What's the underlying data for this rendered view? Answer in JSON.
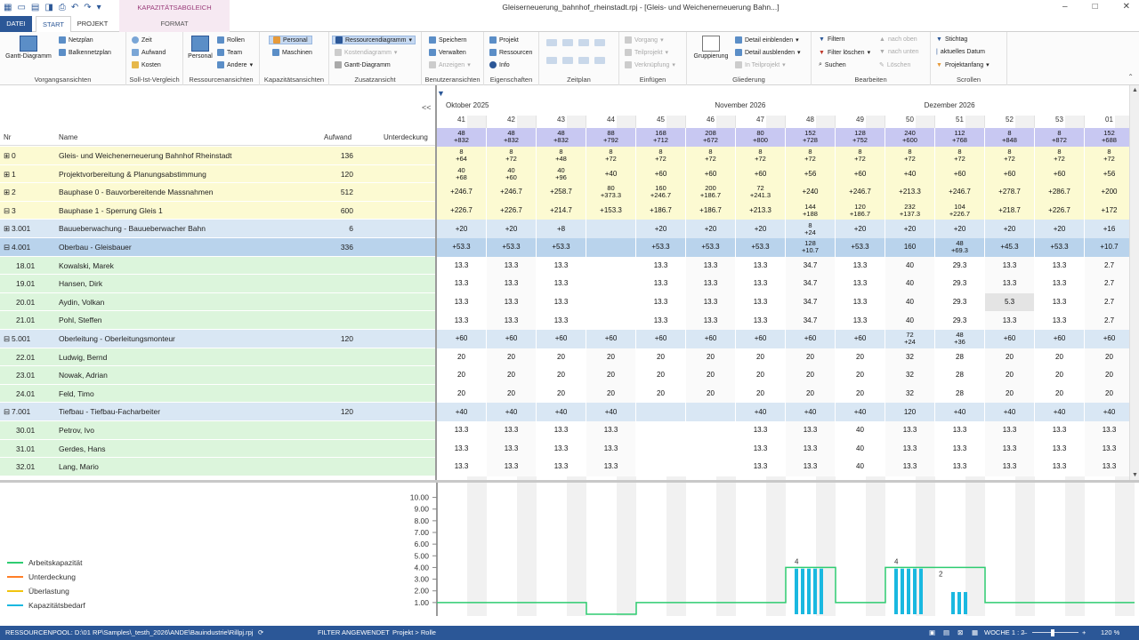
{
  "title_bar": {
    "ctx_tab": "KAPAZITÄTSABGLEICH PERSONAL",
    "doc_title": "Gleiserneuerung_bahnhof_rheinstadt.rpj - [Gleis- und Weichenerneuerung Bahn...]"
  },
  "tabs": {
    "datei": "DATEI",
    "start": "START",
    "projekt": "PROJEKT",
    "format": "FORMAT"
  },
  "ribbon": {
    "vorgangsansichten": {
      "label": "Vorgangsansichten",
      "gantt": "Gantt-Diagramm",
      "netzplan": "Netzplan",
      "balken": "Balkennetzplan"
    },
    "soll_ist": {
      "label": "Soll-Ist-Vergleich",
      "zeit": "Zeit",
      "aufwand": "Aufwand",
      "kosten": "Kosten"
    },
    "ressourcen": {
      "label": "Ressourcenansichten",
      "personal": "Personal",
      "rollen": "Rollen",
      "team": "Team",
      "andere": "Andere"
    },
    "kapazitaet": {
      "label": "Kapazitätsansichten",
      "personal": "Personal",
      "maschinen": "Maschinen"
    },
    "zusatz": {
      "label": "Zusatzansicht",
      "ressourcendiagramm": "Ressourcendiagramm",
      "kostendiagramm": "Kostendiagramm",
      "gantt": "Gantt-Diagramm"
    },
    "benutzer": {
      "label": "Benutzeransichten",
      "speichern": "Speichern",
      "verwalten": "Verwalten",
      "anzeigen": "Anzeigen"
    },
    "eigenschaften": {
      "label": "Eigenschaften",
      "projekt": "Projekt",
      "ressourcen": "Ressourcen",
      "info": "Info"
    },
    "zeitplan": {
      "label": "Zeitplan"
    },
    "einfuegen": {
      "label": "Einfügen",
      "vorgang": "Vorgang",
      "teilprojekt": "Teilprojekt",
      "verknuepfung": "Verknüpfung"
    },
    "gliederung": {
      "label": "Gliederung",
      "gruppierung": "Gruppierung",
      "einblenden": "Detail einblenden",
      "ausblenden": "Detail ausblenden",
      "im_teilprojekt": "In Teilprojekt"
    },
    "bearbeiten": {
      "label": "Bearbeiten",
      "filtern": "Filtern",
      "filter_loeschen": "Filter löschen",
      "suchen": "Suchen",
      "nach_oben": "nach oben",
      "nach_unten": "nach unten",
      "loeschen": "Löschen"
    },
    "scrollen": {
      "label": "Scrollen",
      "stichtag": "Stichtag",
      "aktuelles_datum": "aktuelles Datum",
      "projektanfang": "Projektanfang"
    }
  },
  "table": {
    "col_nr": "Nr",
    "col_name": "Name",
    "col_aufwand": "Aufwand",
    "col_unterdeckung": "Unterdeckung",
    "collapse": "<<",
    "rows": [
      {
        "nr": "0",
        "name": "Gleis- und Weichenerneuerung Bahnhof Rheinstadt",
        "aufwand": "136",
        "style": "y",
        "exp": "⊞"
      },
      {
        "nr": "1",
        "name": "Projektvorbereitung & Planungsabstimmung",
        "aufwand": "120",
        "style": "y",
        "exp": "⊞"
      },
      {
        "nr": "2",
        "name": "Bauphase 0 - Bauvorbereitende Massnahmen",
        "aufwand": "512",
        "style": "y",
        "exp": "⊞"
      },
      {
        "nr": "3",
        "name": "Bauphase 1 - Sperrung Gleis 1",
        "aufwand": "600",
        "style": "y",
        "exp": "⊟"
      },
      {
        "nr": "3.001",
        "name": "Bauueberwachung - Bauueberwacher Bahn",
        "aufwand": "6",
        "style": "b",
        "exp": "⊞"
      },
      {
        "nr": "4.001",
        "name": "Oberbau - Gleisbauer",
        "aufwand": "336",
        "style": "bs",
        "exp": "⊟"
      },
      {
        "nr": "18.01",
        "name": "Kowalski, Marek",
        "aufwand": "",
        "style": "g",
        "exp": ""
      },
      {
        "nr": "19.01",
        "name": "Hansen, Dirk",
        "aufwand": "",
        "style": "g",
        "exp": ""
      },
      {
        "nr": "20.01",
        "name": "Aydin, Volkan",
        "aufwand": "",
        "style": "g",
        "exp": ""
      },
      {
        "nr": "21.01",
        "name": "Pohl, Steffen",
        "aufwand": "",
        "style": "g",
        "exp": ""
      },
      {
        "nr": "5.001",
        "name": "Oberleitung - Oberleitungsmonteur",
        "aufwand": "120",
        "style": "b",
        "exp": "⊟"
      },
      {
        "nr": "22.01",
        "name": "Ludwig, Bernd",
        "aufwand": "",
        "style": "g",
        "exp": ""
      },
      {
        "nr": "23.01",
        "name": "Nowak, Adrian",
        "aufwand": "",
        "style": "g",
        "exp": ""
      },
      {
        "nr": "24.01",
        "name": "Feld, Timo",
        "aufwand": "",
        "style": "g",
        "exp": ""
      },
      {
        "nr": "7.001",
        "name": "Tiefbau - Tiefbau-Facharbeiter",
        "aufwand": "120",
        "style": "b",
        "exp": "⊟"
      },
      {
        "nr": "30.01",
        "name": "Petrov, Ivo",
        "aufwand": "",
        "style": "g",
        "exp": ""
      },
      {
        "nr": "31.01",
        "name": "Gerdes, Hans",
        "aufwand": "",
        "style": "g",
        "exp": ""
      },
      {
        "nr": "32.01",
        "name": "Lang, Mario",
        "aufwand": "",
        "style": "g",
        "exp": ""
      }
    ]
  },
  "timeline": {
    "months": [
      {
        "label": "Oktober 2025",
        "col": 0
      },
      {
        "label": "November 2026",
        "col": 5.4
      },
      {
        "label": "Dezember 2026",
        "col": 9.6
      }
    ],
    "weeks": [
      "41",
      "42",
      "43",
      "44",
      "45",
      "46",
      "47",
      "48",
      "49",
      "50",
      "51",
      "52",
      "53",
      "01"
    ],
    "summary": [
      [
        "48",
        "+832"
      ],
      [
        "48",
        "+832"
      ],
      [
        "48",
        "+832"
      ],
      [
        "88",
        "+792"
      ],
      [
        "168",
        "+712"
      ],
      [
        "208",
        "+672"
      ],
      [
        "80",
        "+800"
      ],
      [
        "152",
        "+728"
      ],
      [
        "128",
        "+752"
      ],
      [
        "240",
        "+600"
      ],
      [
        "112",
        "+768"
      ],
      [
        "8",
        "+848"
      ],
      [
        "8",
        "+872"
      ],
      [
        "152",
        "+688"
      ]
    ],
    "cells": [
      [
        [
          "8",
          "+64"
        ],
        [
          "8",
          "+72"
        ],
        [
          "8",
          "+48"
        ],
        [
          "8",
          "+72"
        ],
        [
          "8",
          "+72"
        ],
        [
          "8",
          "+72"
        ],
        [
          "8",
          "+72"
        ],
        [
          "8",
          "+72"
        ],
        [
          "8",
          "+72"
        ],
        [
          "8",
          "+72"
        ],
        [
          "8",
          "+72"
        ],
        [
          "8",
          "+72"
        ],
        [
          "8",
          "+72"
        ],
        [
          "8",
          "+72"
        ]
      ],
      [
        [
          "40",
          "+68"
        ],
        [
          "40",
          "+60"
        ],
        [
          "40",
          "+96"
        ],
        [
          "+40"
        ],
        [
          "+60"
        ],
        [
          "+60"
        ],
        [
          "+60"
        ],
        [
          "+56"
        ],
        [
          "+60"
        ],
        [
          "+40"
        ],
        [
          "+60"
        ],
        [
          "+60"
        ],
        [
          "+60"
        ],
        [
          "+56"
        ]
      ],
      [
        [
          "+246.7"
        ],
        [
          "+246.7"
        ],
        [
          "+258.7"
        ],
        [
          "80",
          "+373.3"
        ],
        [
          "160",
          "+246.7"
        ],
        [
          "200",
          "+186.7"
        ],
        [
          "72",
          "+241.3"
        ],
        [
          "+240"
        ],
        [
          "+246.7"
        ],
        [
          "+213.3"
        ],
        [
          "+246.7"
        ],
        [
          "+278.7"
        ],
        [
          "+286.7"
        ],
        [
          "+200"
        ]
      ],
      [
        [
          "+226.7"
        ],
        [
          "+226.7"
        ],
        [
          "+214.7"
        ],
        [
          "+153.3"
        ],
        [
          "+186.7"
        ],
        [
          "+186.7"
        ],
        [
          "+213.3"
        ],
        [
          "144",
          "+188"
        ],
        [
          "120",
          "+186.7"
        ],
        [
          "232",
          "+137.3"
        ],
        [
          "104",
          "+226.7"
        ],
        [
          "+218.7"
        ],
        [
          "+226.7"
        ],
        [
          "+172"
        ]
      ],
      [
        [
          "+20"
        ],
        [
          "+20"
        ],
        [
          "+8"
        ],
        [
          ""
        ],
        [
          "+20"
        ],
        [
          "+20"
        ],
        [
          "+20"
        ],
        [
          "8",
          "+24"
        ],
        [
          "+20"
        ],
        [
          "+20"
        ],
        [
          "+20"
        ],
        [
          "+20"
        ],
        [
          "+20"
        ],
        [
          "+16"
        ]
      ],
      [
        [
          "+53.3"
        ],
        [
          "+53.3"
        ],
        [
          "+53.3"
        ],
        [
          ""
        ],
        [
          "+53.3"
        ],
        [
          "+53.3"
        ],
        [
          "+53.3"
        ],
        [
          "128",
          "+10.7"
        ],
        [
          "+53.3"
        ],
        [
          "160"
        ],
        [
          "48",
          "+69.3"
        ],
        [
          "+45.3"
        ],
        [
          "+53.3"
        ],
        [
          "+10.7"
        ]
      ],
      [
        [
          "13.3"
        ],
        [
          "13.3"
        ],
        [
          "13.3"
        ],
        [
          ""
        ],
        [
          "13.3"
        ],
        [
          "13.3"
        ],
        [
          "13.3"
        ],
        [
          "34.7"
        ],
        [
          "13.3"
        ],
        [
          "40"
        ],
        [
          "29.3"
        ],
        [
          "13.3"
        ],
        [
          "13.3"
        ],
        [
          "2.7"
        ]
      ],
      [
        [
          "13.3"
        ],
        [
          "13.3"
        ],
        [
          "13.3"
        ],
        [
          ""
        ],
        [
          "13.3"
        ],
        [
          "13.3"
        ],
        [
          "13.3"
        ],
        [
          "34.7"
        ],
        [
          "13.3"
        ],
        [
          "40"
        ],
        [
          "29.3"
        ],
        [
          "13.3"
        ],
        [
          "13.3"
        ],
        [
          "2.7"
        ]
      ],
      [
        [
          "13.3"
        ],
        [
          "13.3"
        ],
        [
          "13.3"
        ],
        [
          ""
        ],
        [
          "13.3"
        ],
        [
          "13.3"
        ],
        [
          "13.3"
        ],
        [
          "34.7"
        ],
        [
          "13.3"
        ],
        [
          "40"
        ],
        [
          "29.3"
        ],
        [
          "5.3"
        ],
        [
          "13.3"
        ],
        [
          "2.7"
        ]
      ],
      [
        [
          "13.3"
        ],
        [
          "13.3"
        ],
        [
          "13.3"
        ],
        [
          ""
        ],
        [
          "13.3"
        ],
        [
          "13.3"
        ],
        [
          "13.3"
        ],
        [
          "34.7"
        ],
        [
          "13.3"
        ],
        [
          "40"
        ],
        [
          "29.3"
        ],
        [
          "13.3"
        ],
        [
          "13.3"
        ],
        [
          "2.7"
        ]
      ],
      [
        [
          "+60"
        ],
        [
          "+60"
        ],
        [
          "+60"
        ],
        [
          "+60"
        ],
        [
          "+60"
        ],
        [
          "+60"
        ],
        [
          "+60"
        ],
        [
          "+60"
        ],
        [
          "+60"
        ],
        [
          "72",
          "+24"
        ],
        [
          "48",
          "+36"
        ],
        [
          "+60"
        ],
        [
          "+60"
        ],
        [
          "+60"
        ]
      ],
      [
        [
          "20"
        ],
        [
          "20"
        ],
        [
          "20"
        ],
        [
          "20"
        ],
        [
          "20"
        ],
        [
          "20"
        ],
        [
          "20"
        ],
        [
          "20"
        ],
        [
          "20"
        ],
        [
          "32"
        ],
        [
          "28"
        ],
        [
          "20"
        ],
        [
          "20"
        ],
        [
          "20"
        ]
      ],
      [
        [
          "20"
        ],
        [
          "20"
        ],
        [
          "20"
        ],
        [
          "20"
        ],
        [
          "20"
        ],
        [
          "20"
        ],
        [
          "20"
        ],
        [
          "20"
        ],
        [
          "20"
        ],
        [
          "32"
        ],
        [
          "28"
        ],
        [
          "20"
        ],
        [
          "20"
        ],
        [
          "20"
        ]
      ],
      [
        [
          "20"
        ],
        [
          "20"
        ],
        [
          "20"
        ],
        [
          "20"
        ],
        [
          "20"
        ],
        [
          "20"
        ],
        [
          "20"
        ],
        [
          "20"
        ],
        [
          "20"
        ],
        [
          "32"
        ],
        [
          "28"
        ],
        [
          "20"
        ],
        [
          "20"
        ],
        [
          "20"
        ]
      ],
      [
        [
          "+40"
        ],
        [
          "+40"
        ],
        [
          "+40"
        ],
        [
          "+40"
        ],
        [
          ""
        ],
        [
          ""
        ],
        [
          "+40"
        ],
        [
          "+40"
        ],
        [
          "+40"
        ],
        [
          "120"
        ],
        [
          "+40"
        ],
        [
          "+40"
        ],
        [
          "+40"
        ],
        [
          "+40"
        ]
      ],
      [
        [
          "13.3"
        ],
        [
          "13.3"
        ],
        [
          "13.3"
        ],
        [
          "13.3"
        ],
        [
          ""
        ],
        [
          ""
        ],
        [
          "13.3"
        ],
        [
          "13.3"
        ],
        [
          "40"
        ],
        [
          "13.3"
        ],
        [
          "13.3"
        ],
        [
          "13.3"
        ],
        [
          "13.3"
        ],
        [
          "13.3"
        ]
      ],
      [
        [
          "13.3"
        ],
        [
          "13.3"
        ],
        [
          "13.3"
        ],
        [
          "13.3"
        ],
        [
          ""
        ],
        [
          ""
        ],
        [
          "13.3"
        ],
        [
          "13.3"
        ],
        [
          "40"
        ],
        [
          "13.3"
        ],
        [
          "13.3"
        ],
        [
          "13.3"
        ],
        [
          "13.3"
        ],
        [
          "13.3"
        ]
      ],
      [
        [
          "13.3"
        ],
        [
          "13.3"
        ],
        [
          "13.3"
        ],
        [
          "13.3"
        ],
        [
          ""
        ],
        [
          ""
        ],
        [
          "13.3"
        ],
        [
          "13.3"
        ],
        [
          "40"
        ],
        [
          "13.3"
        ],
        [
          "13.3"
        ],
        [
          "13.3"
        ],
        [
          "13.3"
        ],
        [
          "13.3"
        ]
      ]
    ]
  },
  "chart_data": {
    "type": "line",
    "y_ticks": [
      "10.00",
      "9.00",
      "8.00",
      "7.00",
      "6.00",
      "5.00",
      "4.00",
      "3.00",
      "2.00",
      "1.00"
    ],
    "ylim": [
      0,
      10.5
    ],
    "series": [
      {
        "name": "Arbeitskapazität",
        "color": "#2ecc71"
      },
      {
        "name": "Unterdeckung",
        "color": "#ff7f27"
      },
      {
        "name": "Überlastung",
        "color": "#f1c40f"
      },
      {
        "name": "Kapazitätsbedarf",
        "color": "#1ab8e0"
      }
    ],
    "capacity_steps": [
      [
        0,
        1
      ],
      [
        3,
        1
      ],
      [
        3,
        0
      ],
      [
        4,
        0
      ],
      [
        4,
        1
      ],
      [
        7,
        1
      ],
      [
        7,
        4
      ],
      [
        8,
        4
      ],
      [
        8,
        1
      ],
      [
        9,
        1
      ],
      [
        9,
        4
      ],
      [
        11,
        4
      ],
      [
        11,
        1
      ],
      [
        14,
        1
      ]
    ],
    "demand_bars": [
      {
        "week": 7,
        "value": 4,
        "label": "4"
      },
      {
        "week": 9,
        "value": 4,
        "label": "4"
      },
      {
        "week": 10,
        "value": 2,
        "label": "2"
      }
    ]
  },
  "statusbar": {
    "pool": "RESSOURCENPOOL: D:\\01 RP\\Samples\\_testh_2026\\ANDE\\Bauindustrie\\Rillpj.rpj",
    "filter": "FILTER ANGEWENDET",
    "gruppe": "Projekt > Rolle",
    "woche": "WOCHE 1 : 2",
    "zoom": "120 %"
  },
  "colors": {
    "accent": "#2b5797",
    "capacity": "#2ecc71",
    "demand": "#1ab8e0"
  }
}
